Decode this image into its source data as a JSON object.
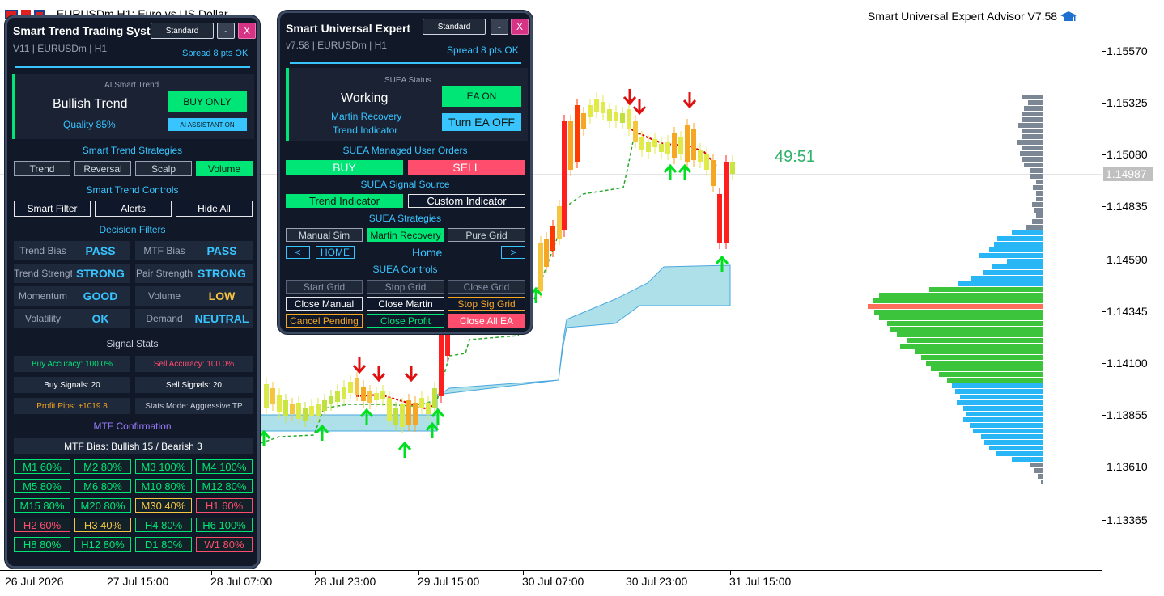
{
  "window": {
    "title": "EURUSDm,H1:  Euro vs US Dollar"
  },
  "ea_label": "Smart Universal Expert Advisor V7.58",
  "countdown": "49:51",
  "price_axis": {
    "labels": [
      "1.15570",
      "1.15325",
      "1.15080",
      "1.14835",
      "1.14590",
      "1.14345",
      "1.14100",
      "1.13855",
      "1.13610",
      "1.13365"
    ],
    "current": "1.14987"
  },
  "time_axis": [
    "26 Jul 2026",
    "27 Jul 15:00",
    "28 Jul 07:00",
    "28 Jul 23:00",
    "29 Jul 15:00",
    "30 Jul 07:00",
    "30 Jul 23:00",
    "31 Jul 15:00"
  ],
  "sts": {
    "title": "Smart Trend Trading System",
    "mode": "Standard",
    "min": "-",
    "close": "X",
    "version": "V11 | EURUSDm | H1",
    "spread": "Spread 8 pts OK",
    "ai_label": "AI Smart Trend",
    "trend": "Bullish Trend",
    "quality": "Quality 85%",
    "buy_only": "BUY ONLY",
    "ai_assist": "AI ASSISTANT ON",
    "strategies_header": "Smart Trend Strategies",
    "strategies": [
      "Trend",
      "Reversal",
      "Scalp",
      "Volume"
    ],
    "controls_header": "Smart Trend Controls",
    "controls": [
      "Smart Filter",
      "Alerts",
      "Hide All"
    ],
    "filters_header": "Decision Filters",
    "filters": [
      {
        "label": "Trend Bias",
        "value": "PASS",
        "color": "#38c4ff"
      },
      {
        "label": "MTF Bias",
        "value": "PASS",
        "color": "#38c4ff"
      },
      {
        "label": "Trend Strength",
        "value": "STRONG",
        "color": "#38c4ff"
      },
      {
        "label": "Pair Strength",
        "value": "STRONG",
        "color": "#38c4ff"
      },
      {
        "label": "Momentum",
        "value": "GOOD",
        "color": "#38c4ff"
      },
      {
        "label": "Volume",
        "value": "LOW",
        "color": "#f5c542"
      },
      {
        "label": "Volatility",
        "value": "OK",
        "color": "#38c4ff"
      },
      {
        "label": "Demand",
        "value": "NEUTRAL",
        "color": "#38c4ff"
      }
    ],
    "signal_header": "Signal Stats",
    "buy_acc": "Buy Accuracy: 100.0%",
    "sell_acc": "Sell Accuracy: 100.0%",
    "buy_signals": "Buy Signals: 20",
    "sell_signals": "Sell Signals: 20",
    "profit_pips": "Profit Pips: +1019.8",
    "stats_mode": "Stats Mode: Aggressive TP",
    "mtf_header": "MTF Confirmation",
    "mtf_bias": "MTF Bias: Bullish 15 / Bearish 3",
    "mtf": [
      {
        "t": "M1 60%",
        "c": "#00e676"
      },
      {
        "t": "M2 80%",
        "c": "#00e676"
      },
      {
        "t": "M3 100%",
        "c": "#00e676"
      },
      {
        "t": "M4 100%",
        "c": "#00e676"
      },
      {
        "t": "M5 80%",
        "c": "#00e676"
      },
      {
        "t": "M6 80%",
        "c": "#00e676"
      },
      {
        "t": "M10 80%",
        "c": "#00e676"
      },
      {
        "t": "M12 80%",
        "c": "#00e676"
      },
      {
        "t": "M15 80%",
        "c": "#00e676"
      },
      {
        "t": "M20 80%",
        "c": "#00e676"
      },
      {
        "t": "M30 40%",
        "c": "#f5c542"
      },
      {
        "t": "H1 60%",
        "c": "#ff4d6d"
      },
      {
        "t": "H2 60%",
        "c": "#ff4d6d"
      },
      {
        "t": "H3 40%",
        "c": "#f5c542"
      },
      {
        "t": "H4 80%",
        "c": "#00e676"
      },
      {
        "t": "H6 100%",
        "c": "#00e676"
      },
      {
        "t": "H8 80%",
        "c": "#00e676"
      },
      {
        "t": "H12 80%",
        "c": "#00e676"
      },
      {
        "t": "D1 80%",
        "c": "#00e676"
      },
      {
        "t": "W1 80%",
        "c": "#ff4d6d"
      }
    ]
  },
  "suea": {
    "title": "Smart Universal Expert",
    "mode": "Standard",
    "min": "-",
    "close": "X",
    "version": "v7.58 | EURUSDm | H1",
    "spread": "Spread 8 pts OK",
    "status_label": "SUEA Status",
    "status": "Working",
    "mode1": "Martin Recovery",
    "mode2": "Trend Indicator",
    "ea_on": "EA ON",
    "turn_off": "Turn EA OFF",
    "orders_header": "SUEA Managed User Orders",
    "buy": "BUY",
    "sell": "SELL",
    "signal_header": "SUEA Signal Source",
    "trend_ind": "Trend Indicator",
    "custom_ind": "Custom Indicator",
    "strat_header": "SUEA Strategies",
    "strats": [
      "Manual Sim",
      "Martin Recovery",
      "Pure Grid"
    ],
    "prev": "<",
    "home_btn": "HOME",
    "home_label": "Home",
    "next": ">",
    "controls_header": "SUEA Controls",
    "controls_row1": [
      "Start Grid",
      "Stop Grid",
      "Close Grid"
    ],
    "controls_row2": [
      "Close Manual",
      "Close Martin",
      "Stop Sig Grid"
    ],
    "controls_row3": [
      "Cancel Pending",
      "Close Profit",
      "Close All EA"
    ]
  }
}
